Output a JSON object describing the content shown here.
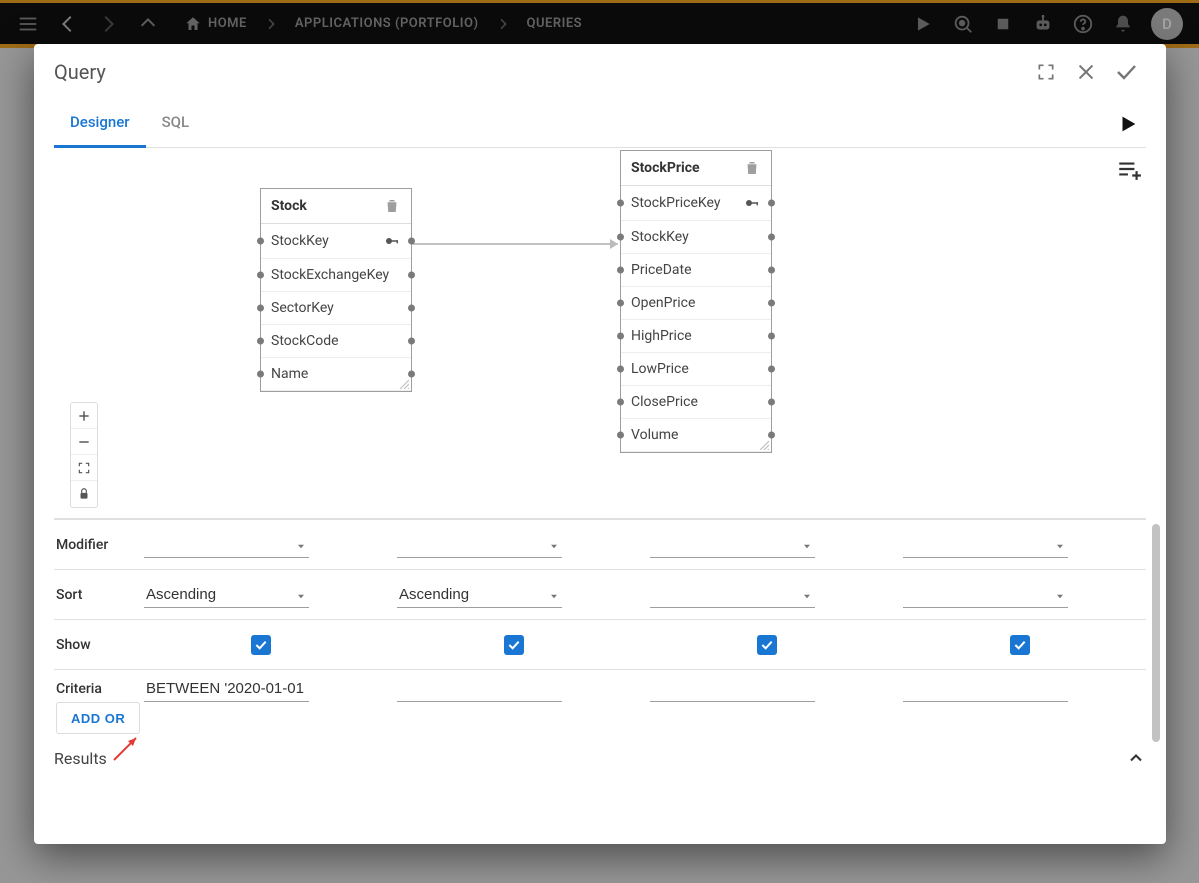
{
  "toolbar": {
    "breadcrumbs": [
      "HOME",
      "APPLICATIONS (PORTFOLIO)",
      "QUERIES"
    ],
    "avatar_initial": "D"
  },
  "modal": {
    "title": "Query",
    "tabs": {
      "designer": "Designer",
      "sql": "SQL"
    }
  },
  "designer": {
    "tables": {
      "stock": {
        "name": "Stock",
        "fields": [
          "StockKey",
          "StockExchangeKey",
          "SectorKey",
          "StockCode",
          "Name"
        ],
        "key_field_index": 0
      },
      "stockprice": {
        "name": "StockPrice",
        "fields": [
          "StockPriceKey",
          "StockKey",
          "PriceDate",
          "OpenPrice",
          "HighPrice",
          "LowPrice",
          "ClosePrice",
          "Volume"
        ],
        "key_field_index": 0
      }
    }
  },
  "grid": {
    "labels": {
      "modifier": "Modifier",
      "sort": "Sort",
      "show": "Show",
      "criteria": "Criteria"
    },
    "columns": [
      {
        "modifier": "",
        "sort": "Ascending",
        "show": true,
        "criteria": "BETWEEN '2020-01-01"
      },
      {
        "modifier": "",
        "sort": "Ascending",
        "show": true,
        "criteria": ""
      },
      {
        "modifier": "",
        "sort": "",
        "show": true,
        "criteria": ""
      },
      {
        "modifier": "",
        "sort": "",
        "show": true,
        "criteria": ""
      }
    ],
    "add_or_label": "ADD OR"
  },
  "results_label": "Results"
}
